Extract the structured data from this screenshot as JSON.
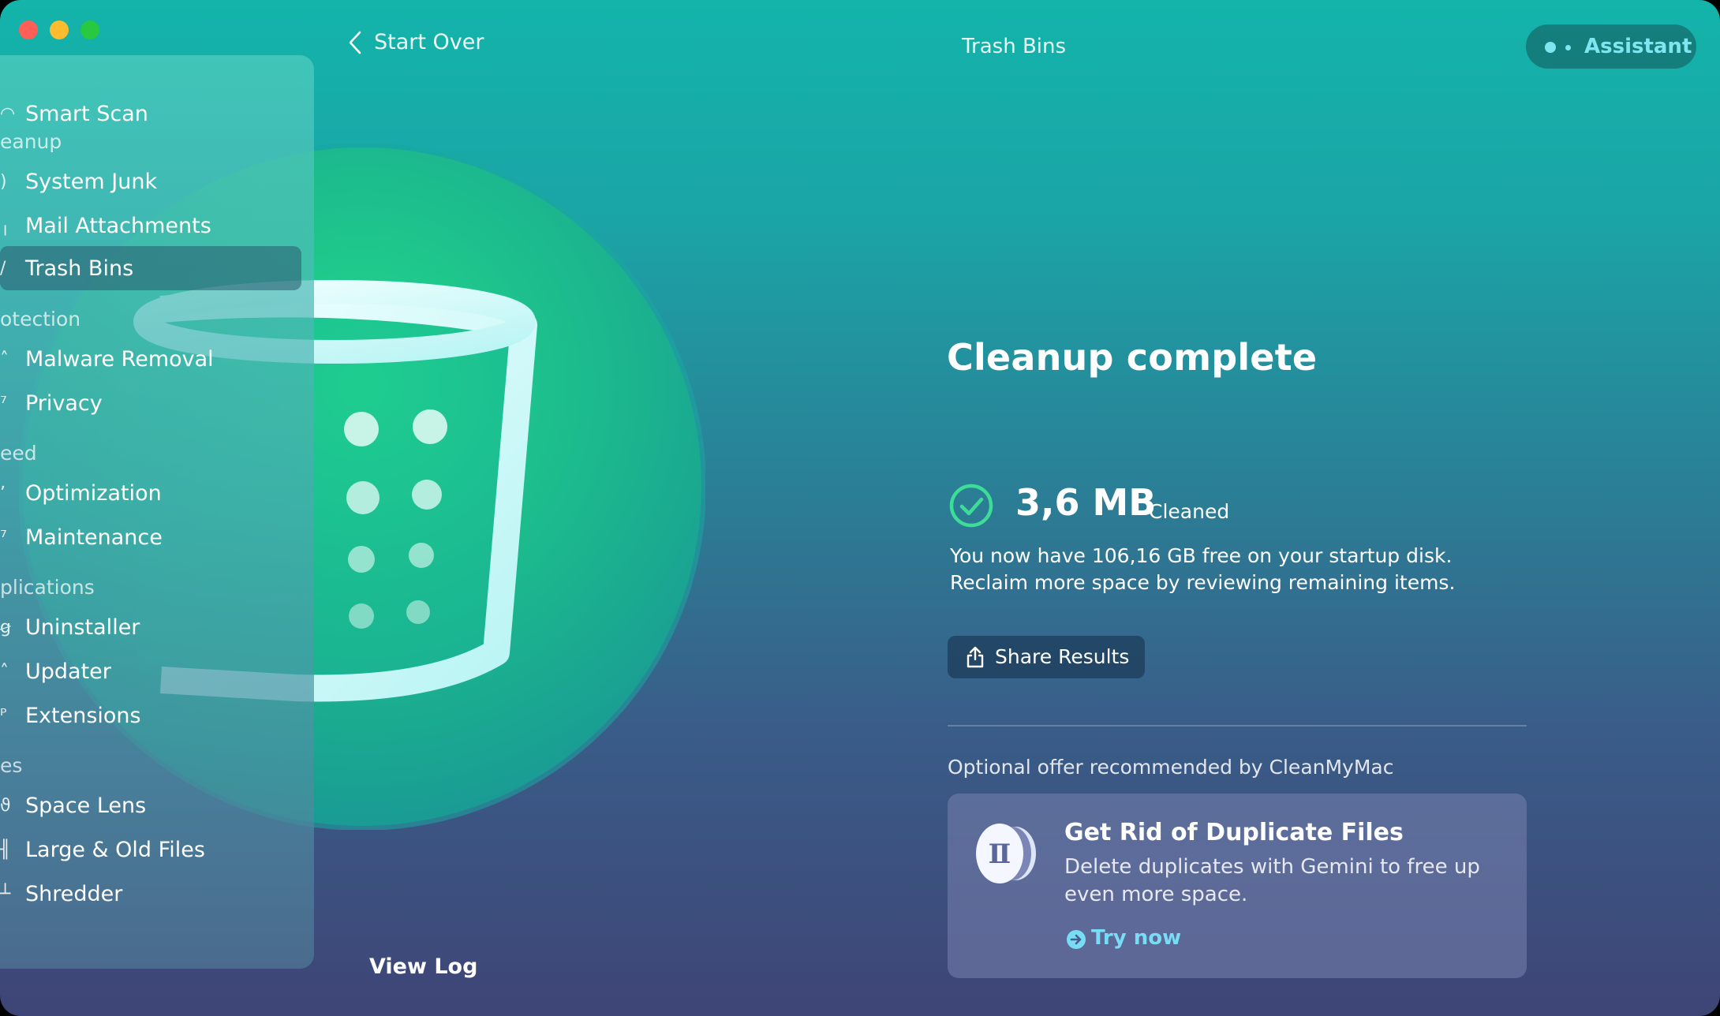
{
  "window": {
    "title": "Trash Bins"
  },
  "topbar": {
    "back_label": "Start Over",
    "title": "Trash Bins",
    "assistant_label": "Assistant"
  },
  "sidebar": {
    "items": [
      {
        "label": "Smart Scan",
        "icon": "smart-scan-icon"
      },
      {
        "section": "eanup"
      },
      {
        "label": "System Junk",
        "icon": "system-junk-icon"
      },
      {
        "label": "Mail Attachments",
        "icon": "mail-attachments-icon"
      },
      {
        "label": "Trash Bins",
        "icon": "trash-bins-icon",
        "active": true
      },
      {
        "section": "otection"
      },
      {
        "label": "Malware Removal",
        "icon": "malware-removal-icon"
      },
      {
        "label": "Privacy",
        "icon": "privacy-icon"
      },
      {
        "section": "eed"
      },
      {
        "label": "Optimization",
        "icon": "optimization-icon"
      },
      {
        "label": "Maintenance",
        "icon": "maintenance-icon"
      },
      {
        "section": "plications"
      },
      {
        "label": "Uninstaller",
        "icon": "uninstaller-icon"
      },
      {
        "label": "Updater",
        "icon": "updater-icon"
      },
      {
        "label": "Extensions",
        "icon": "extensions-icon"
      },
      {
        "section": "es"
      },
      {
        "label": "Space Lens",
        "icon": "space-lens-icon"
      },
      {
        "label": "Large & Old Files",
        "icon": "large-old-files-icon"
      },
      {
        "label": "Shredder",
        "icon": "shredder-icon"
      }
    ]
  },
  "result": {
    "title": "Cleanup complete",
    "cleaned_size": "3,6 MB",
    "cleaned_label": "Cleaned",
    "desc_line1": "You now have 106,16 GB free on your startup disk.",
    "desc_line2": "Reclaim more space by reviewing remaining items.",
    "share_label": "Share Results"
  },
  "offer": {
    "caption": "Optional offer recommended by CleanMyMac",
    "title": "Get Rid of Duplicate Files",
    "desc_line1": "Delete duplicates with Gemini to free up",
    "desc_line2": "even more space.",
    "cta": "Try now",
    "logo_icon": "gemini-icon"
  },
  "footer": {
    "view_log": "View Log"
  },
  "colors": {
    "accent_cyan": "#78dcf4",
    "check_green": "#3ddc97",
    "hero_green": "#1fcf86"
  }
}
